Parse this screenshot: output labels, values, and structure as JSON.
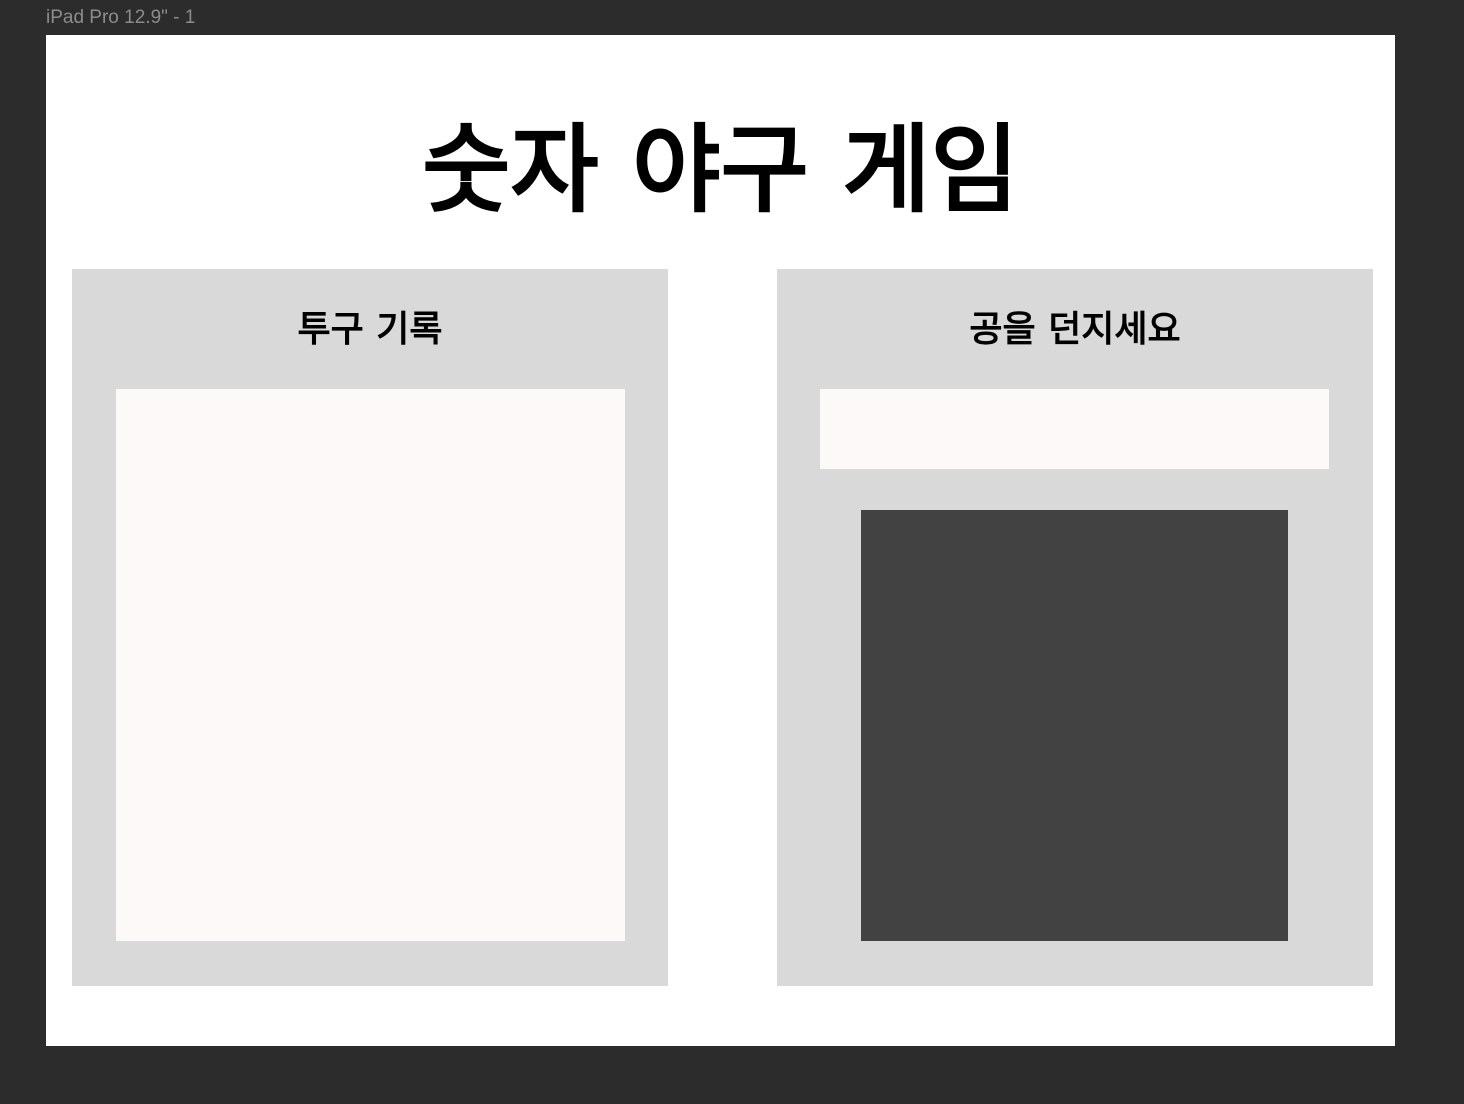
{
  "frame_label": "iPad Pro 12.9\" - 1",
  "title": "숫자 야구 게임",
  "left_panel": {
    "heading": "투구 기록"
  },
  "right_panel": {
    "heading": "공을 던지세요",
    "input_value": ""
  },
  "colors": {
    "canvas": "#2c2c2c",
    "frame": "#ffffff",
    "panel": "#d9d9d9",
    "box": "#fdf9f8",
    "pad": "#424242"
  }
}
